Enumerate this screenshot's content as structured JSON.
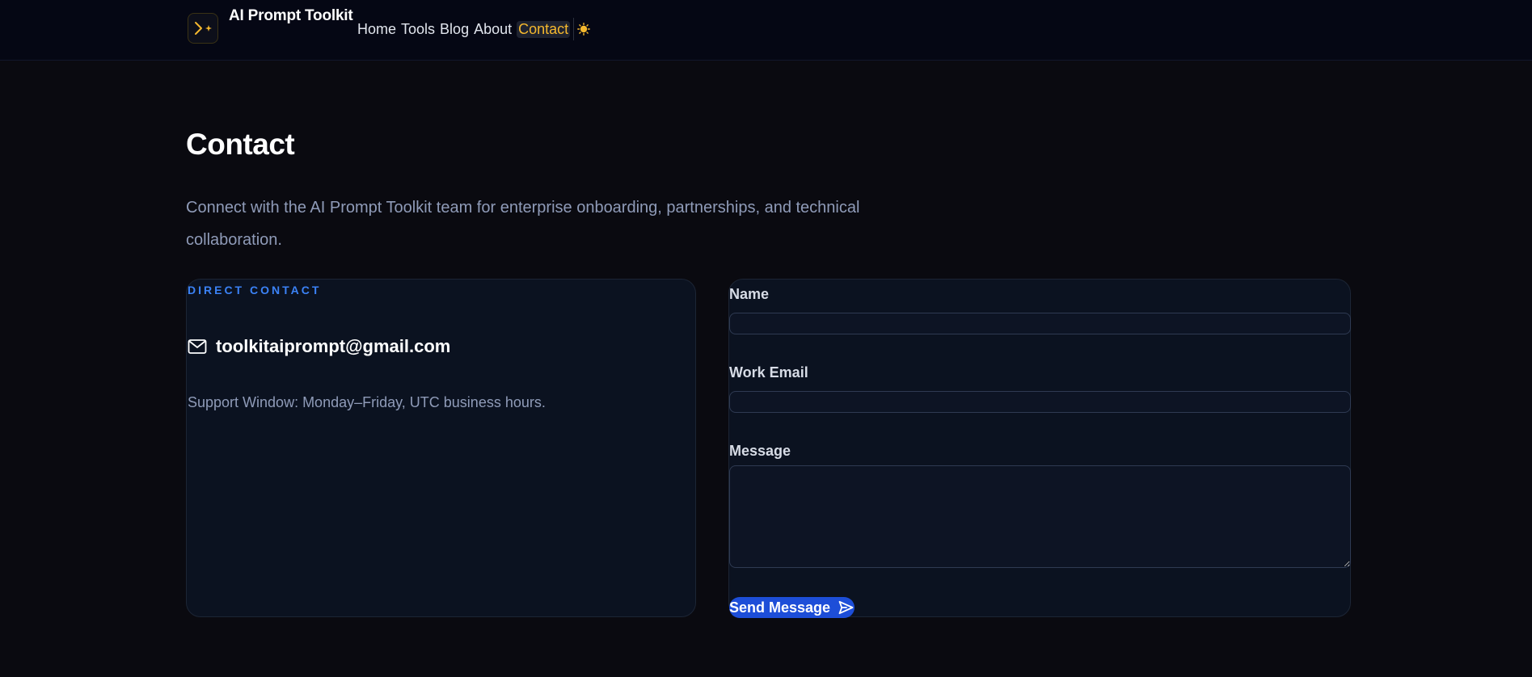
{
  "header": {
    "brand": "AI Prompt Toolkit",
    "logo_icon": "terminal-sparkle-icon",
    "nav": [
      {
        "label": "Home",
        "active": false
      },
      {
        "label": "Tools",
        "active": false
      },
      {
        "label": "Blog",
        "active": false
      },
      {
        "label": "About",
        "active": false
      },
      {
        "label": "Contact",
        "active": true
      }
    ],
    "theme_icon": "sun-icon"
  },
  "page": {
    "title": "Contact",
    "intro": "Connect with the AI Prompt Toolkit team for enterprise onboarding, partnerships, and technical collaboration."
  },
  "direct_contact": {
    "eyebrow": "DIRECT CONTACT",
    "email_icon": "mail-icon",
    "email": "toolkitaiprompt@gmail.com",
    "support": "Support Window: Monday–Friday, UTC business hours."
  },
  "form": {
    "name_label": "Name",
    "name_value": "",
    "email_label": "Work Email",
    "email_value": "",
    "message_label": "Message",
    "message_value": "",
    "submit_label": "Send Message",
    "submit_icon": "send-icon"
  },
  "colors": {
    "accent": "#f5b82e",
    "primary": "#1d4ed8",
    "eyebrow": "#3b82f6",
    "background": "#0a0a10",
    "muted_text": "#8f9bb8"
  }
}
